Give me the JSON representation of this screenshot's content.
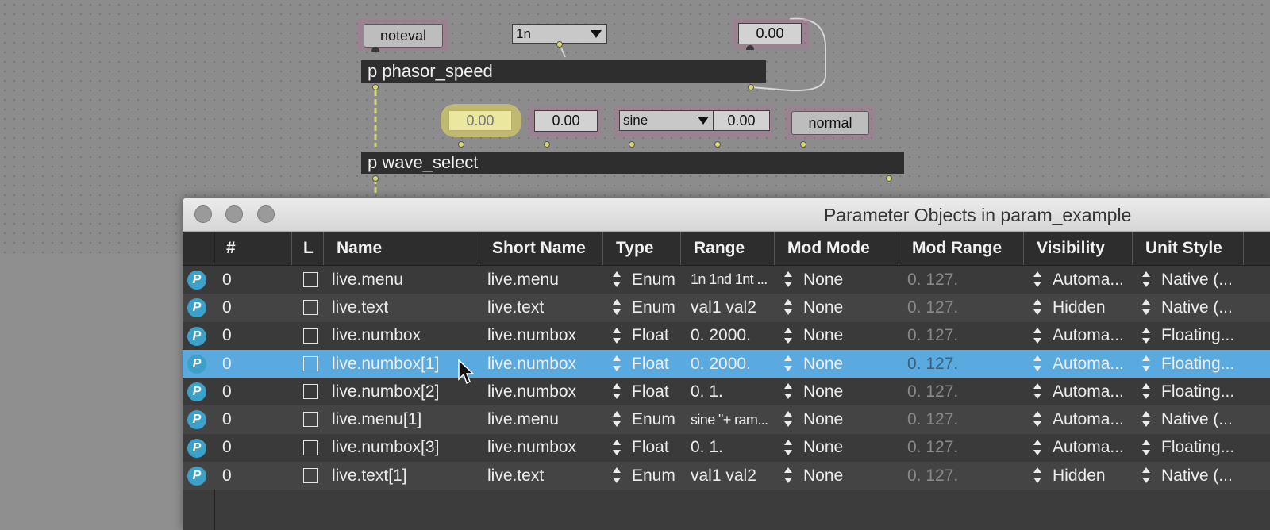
{
  "patch": {
    "noteval_label": "noteval",
    "menu_1n_value": "1n",
    "num_top_value": "0.00",
    "phasor_speed_label": "p phasor_speed",
    "num_yellow_value": "0.00",
    "num_mid_value": "0.00",
    "sine_menu_value": "sine",
    "num_right_value": "0.00",
    "normal_label": "normal",
    "wave_select_label": "p wave_select"
  },
  "window": {
    "title": "Parameter Objects in param_example"
  },
  "table": {
    "headers": {
      "num": "#",
      "l": "L",
      "name": "Name",
      "short_name": "Short Name",
      "type": "Type",
      "range": "Range",
      "mod_mode": "Mod Mode",
      "mod_range": "Mod Range",
      "visibility": "Visibility",
      "unit_style": "Unit Style"
    },
    "rows": [
      {
        "num": "0",
        "name": "live.menu",
        "short": "live.menu",
        "type": "Enum",
        "range": "1n 1nd 1nt ...",
        "mod": "None",
        "modrange": "0. 127.",
        "vis": "Automa...",
        "unit": "Native (..."
      },
      {
        "num": "0",
        "name": "live.text",
        "short": "live.text",
        "type": "Enum",
        "range": "val1 val2",
        "mod": "None",
        "modrange": "0. 127.",
        "vis": "Hidden",
        "unit": "Native (..."
      },
      {
        "num": "0",
        "name": "live.numbox",
        "short": "live.numbox",
        "type": "Float",
        "range": "0. 2000.",
        "mod": "None",
        "modrange": "0. 127.",
        "vis": "Automa...",
        "unit": "Floating..."
      },
      {
        "num": "0",
        "name": "live.numbox[1]",
        "short": "live.numbox",
        "type": "Float",
        "range": "0. 2000.",
        "mod": "None",
        "modrange": "0. 127.",
        "vis": "Automa...",
        "unit": "Floating..."
      },
      {
        "num": "0",
        "name": "live.numbox[2]",
        "short": "live.numbox",
        "type": "Float",
        "range": "0. 1.",
        "mod": "None",
        "modrange": "0. 127.",
        "vis": "Automa...",
        "unit": "Floating..."
      },
      {
        "num": "0",
        "name": "live.menu[1]",
        "short": "live.menu",
        "type": "Enum",
        "range": "sine \"+ ram...",
        "mod": "None",
        "modrange": "0. 127.",
        "vis": "Automa...",
        "unit": "Native (..."
      },
      {
        "num": "0",
        "name": "live.numbox[3]",
        "short": "live.numbox",
        "type": "Float",
        "range": "0. 1.",
        "mod": "None",
        "modrange": "0. 127.",
        "vis": "Automa...",
        "unit": "Floating..."
      },
      {
        "num": "0",
        "name": "live.text[1]",
        "short": "live.text",
        "type": "Enum",
        "range": "val1 val2",
        "mod": "None",
        "modrange": "0. 127.",
        "vis": "Hidden",
        "unit": "Native (..."
      }
    ]
  },
  "icons": {
    "row_icon_letter": "P"
  },
  "colors": {
    "selected_row": "#5aa9df",
    "param_icon": "#3ca1c8"
  }
}
